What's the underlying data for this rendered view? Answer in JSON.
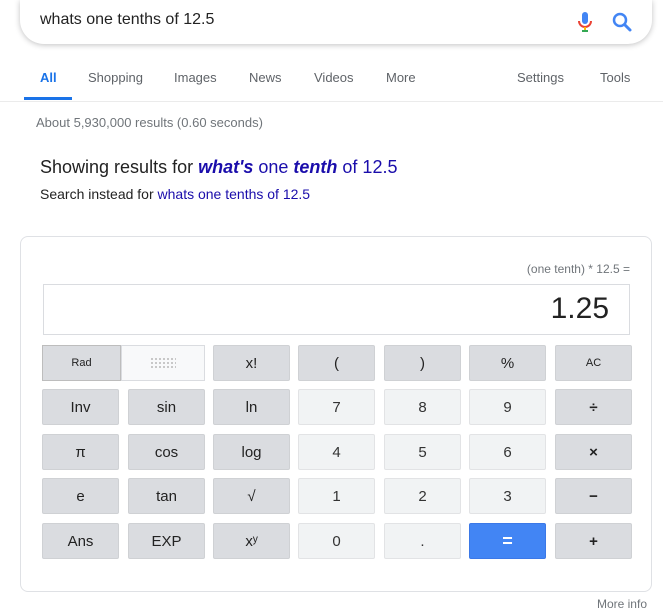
{
  "search": {
    "query": "whats one tenths of 12.5"
  },
  "tabs": [
    {
      "label": "All"
    },
    {
      "label": "Shopping"
    },
    {
      "label": "Images"
    },
    {
      "label": "News"
    },
    {
      "label": "Videos"
    },
    {
      "label": "More"
    }
  ],
  "tools": {
    "settings": "Settings",
    "tools": "Tools"
  },
  "stats": "About 5,930,000 results (0.60 seconds)",
  "spelling": {
    "prefix": "Showing results for ",
    "w1": "what's",
    "w2": " one ",
    "w3": "tenth",
    "w4": " of 12.5",
    "instead_prefix": "Search instead for ",
    "instead_link": "whats one tenths of 12.5"
  },
  "calculator": {
    "expression": "(one tenth) * 12.5 =",
    "result": "1.25",
    "rad": "Rad",
    "keys": {
      "fact": "x!",
      "lparen": "(",
      "rparen": ")",
      "percent": "%",
      "ac": "AC",
      "inv": "Inv",
      "sin": "sin",
      "ln": "ln",
      "n7": "7",
      "n8": "8",
      "n9": "9",
      "div": "÷",
      "pi": "π",
      "cos": "cos",
      "log": "log",
      "n4": "4",
      "n5": "5",
      "n6": "6",
      "mul": "×",
      "e": "e",
      "tan": "tan",
      "sqrt": "√",
      "n1": "1",
      "n2": "2",
      "n3": "3",
      "minus": "−",
      "ans": "Ans",
      "exp": "EXP",
      "pow": "xʸ",
      "n0": "0",
      "dot": ".",
      "eq": "=",
      "plus": "+"
    }
  },
  "more_info": "More info"
}
